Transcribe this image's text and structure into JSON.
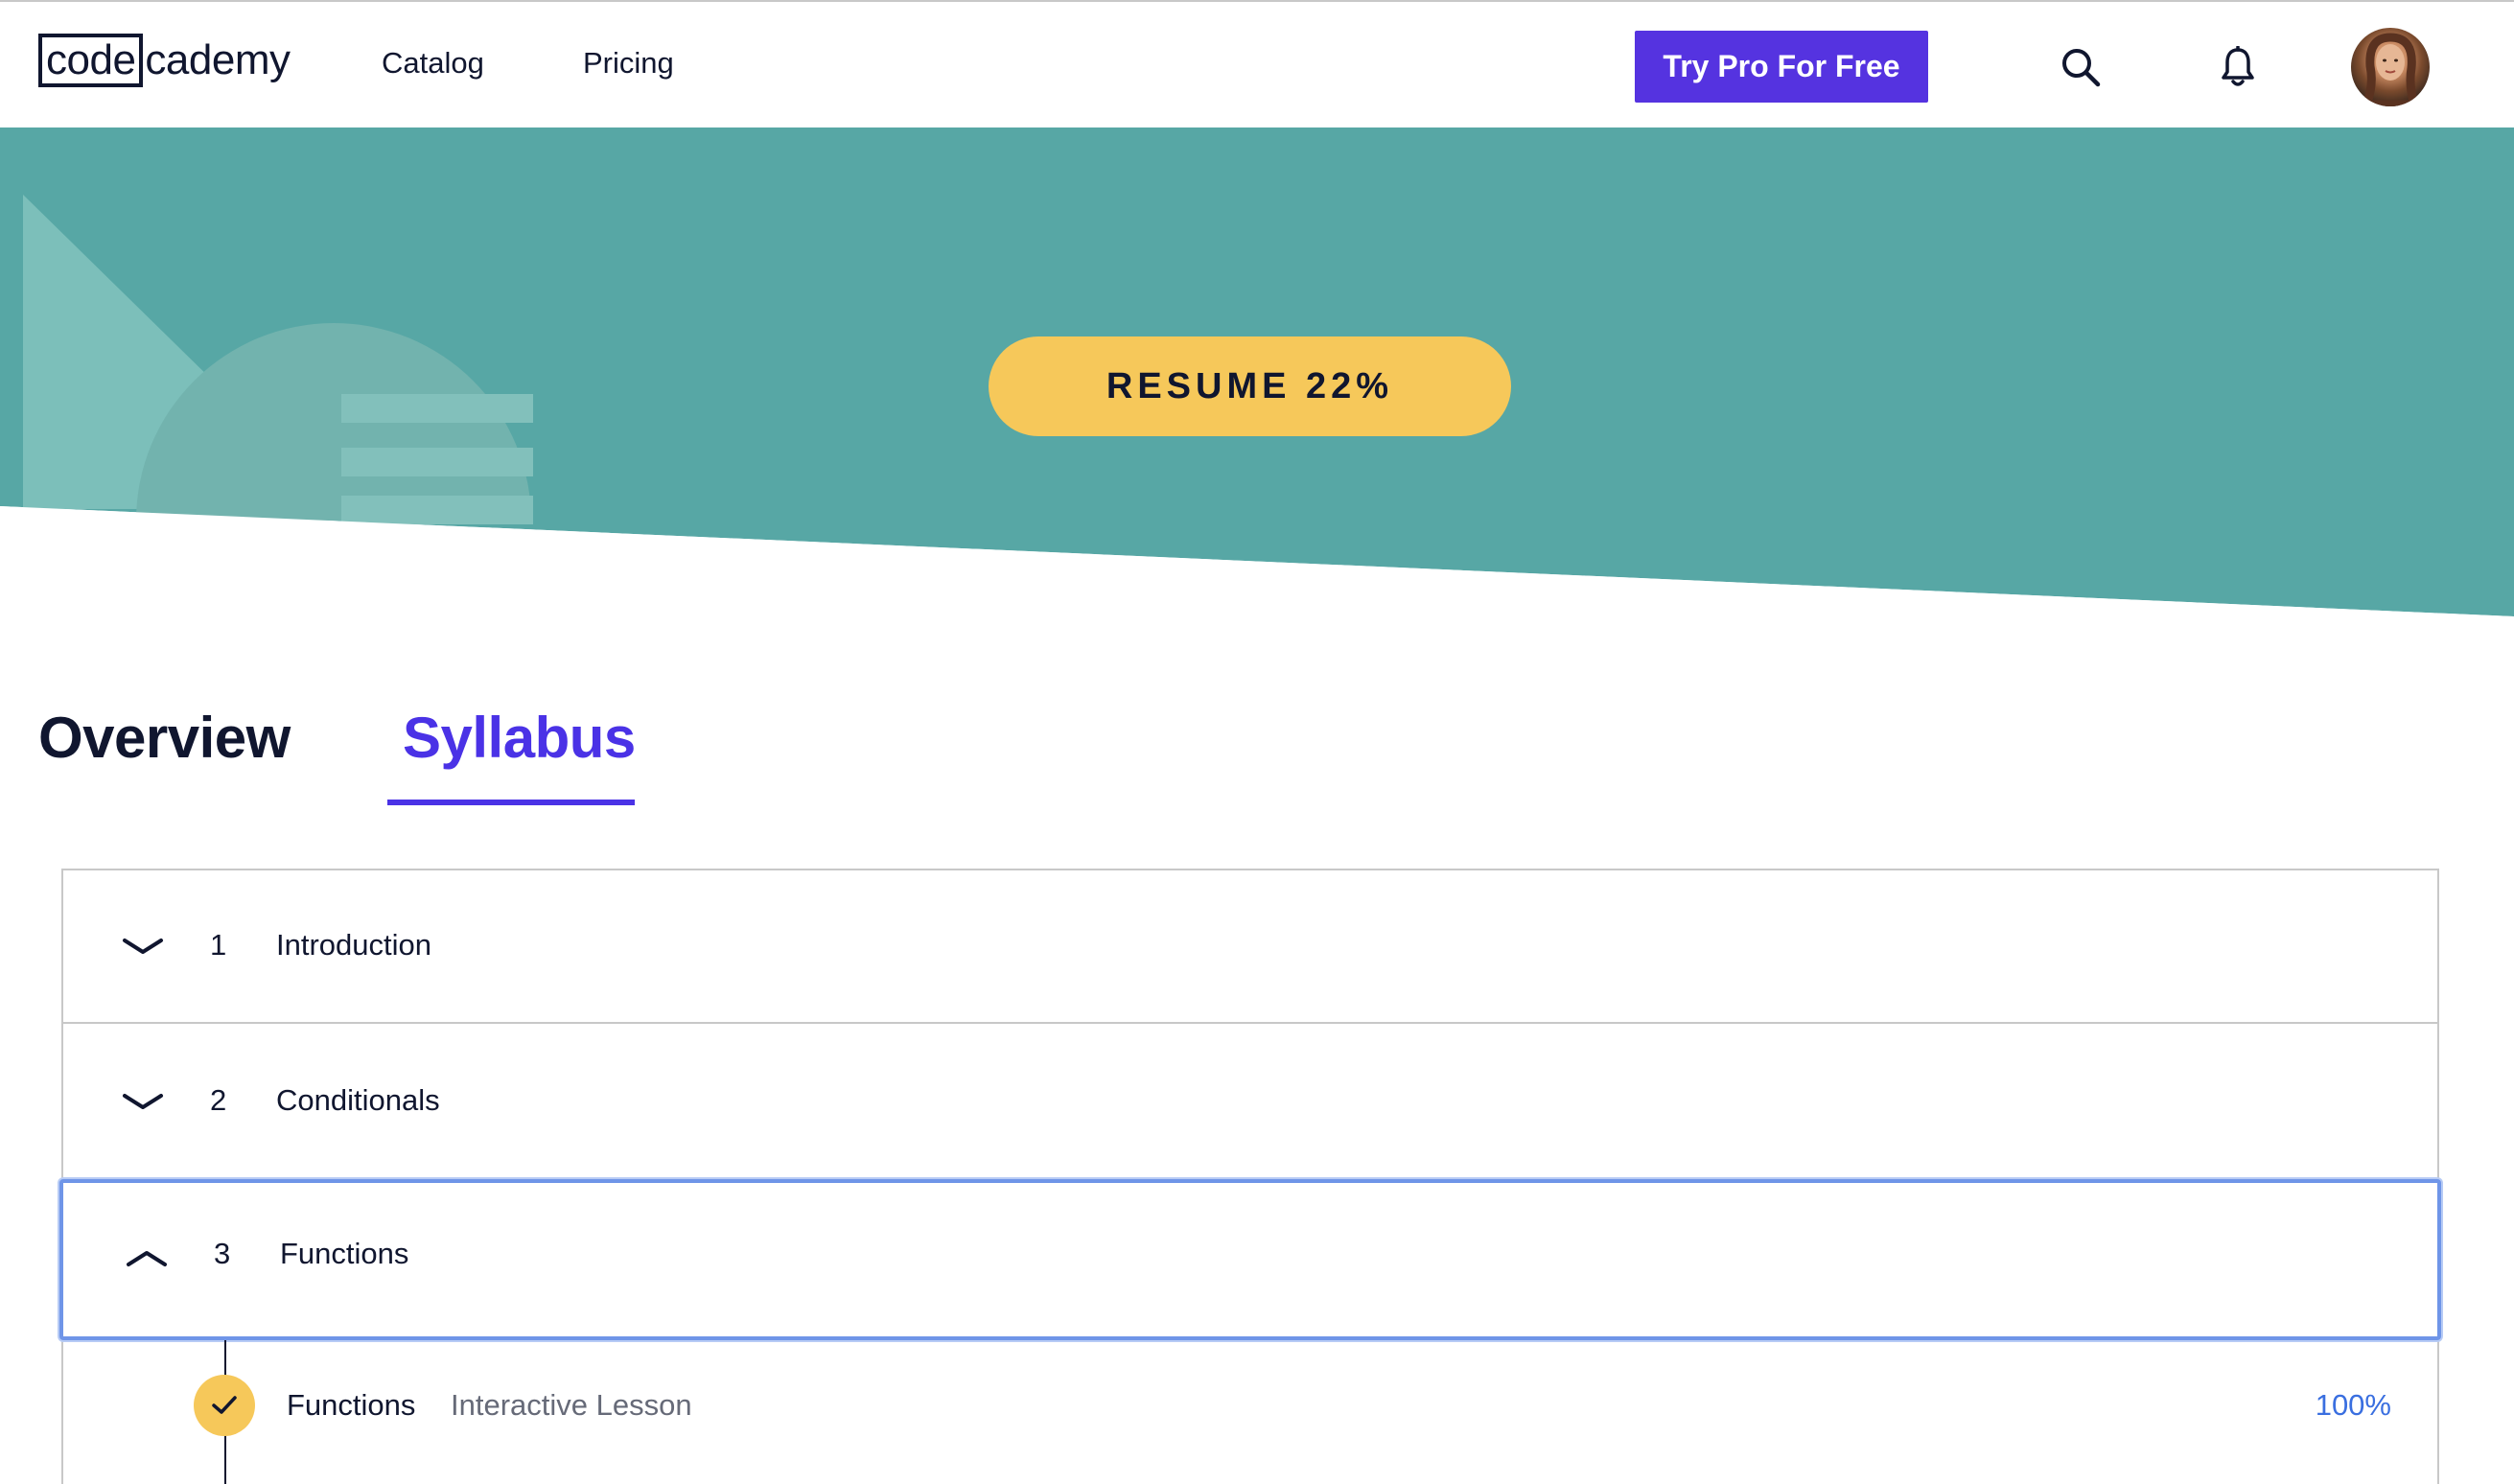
{
  "header": {
    "logo": {
      "boxed": "code",
      "rest": "cademy"
    },
    "nav": {
      "catalog": "Catalog",
      "pricing": "Pricing"
    },
    "cta_label": "Try Pro For Free",
    "icons": {
      "search": "search-icon",
      "notifications": "bell-icon"
    }
  },
  "hero": {
    "resume_label": "RESUME 22%",
    "progress_percent": 22
  },
  "tabs": [
    {
      "label": "Overview",
      "active": false
    },
    {
      "label": "Syllabus",
      "active": true
    }
  ],
  "syllabus": {
    "modules": [
      {
        "number": "1",
        "title": "Introduction",
        "expanded": false
      },
      {
        "number": "2",
        "title": "Conditionals",
        "expanded": false
      },
      {
        "number": "3",
        "title": "Functions",
        "expanded": true
      }
    ],
    "lessons": [
      {
        "title": "Functions",
        "type": "Interactive Lesson",
        "progress": "100%",
        "completed": true
      }
    ]
  },
  "colors": {
    "brand_purple": "#5533e0",
    "tab_active": "#4a32e6",
    "hero_teal": "#57a7a5",
    "resume_yellow": "#f6c85a",
    "focus_blue": "#6f95e8",
    "progress_blue": "#3a6fe0",
    "text_dark": "#10162f"
  }
}
